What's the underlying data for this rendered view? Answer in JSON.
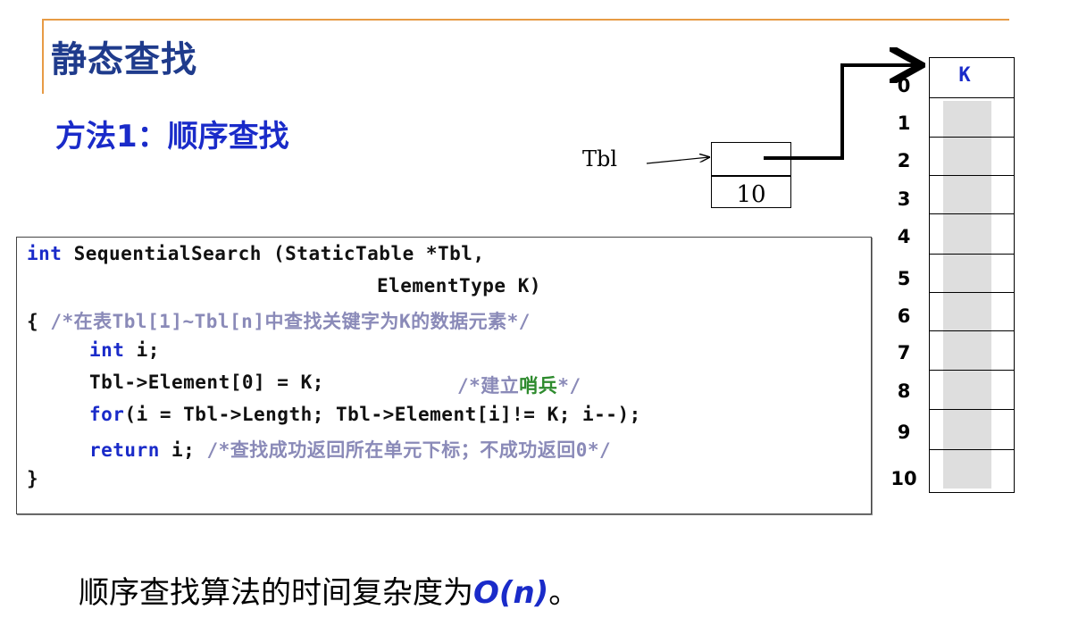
{
  "slide": {
    "title": "静态查找",
    "method": "方法1：顺序查找"
  },
  "diagram": {
    "tbl_label": "Tbl",
    "length_value": "10",
    "array_header": "K",
    "indices": [
      "0",
      "1",
      "2",
      "3",
      "4",
      "5",
      "6",
      "7",
      "8",
      "9",
      "10"
    ]
  },
  "code": {
    "l1_kw": "int",
    "l1_rest": " SequentialSearch (StaticTable *Tbl,",
    "l2": "ElementType K)",
    "l3_brace": "{",
    "l3_comment": "/*在表Tbl[1]~Tbl[n]中查找关键字为K的数据元素*/",
    "l4_kw": "int",
    "l4_rest": " i;",
    "l5_code": "Tbl->Element[0] = K;",
    "l5_comment_a": "/*建立",
    "l5_comment_b": "哨兵",
    "l5_comment_c": "*/",
    "l6_kw": "for",
    "l6_rest": "(i = Tbl->Length; Tbl->Element[i]!= K; i--);",
    "l7_kw": "return",
    "l7_rest": " i;",
    "l7_comment": "/*查找成功返回所在单元下标；不成功返回0*/",
    "l8_brace": "}"
  },
  "conclusion": {
    "text": "顺序查找算法的时间复杂度为",
    "big_o": "O(n)",
    "suffix": "。"
  },
  "colors": {
    "title": "#1f3b8c",
    "keyword": "#1a2bc9",
    "comment": "#8a8ab8",
    "sentinel": "#2e8b2e",
    "rule": "#e79b45"
  }
}
